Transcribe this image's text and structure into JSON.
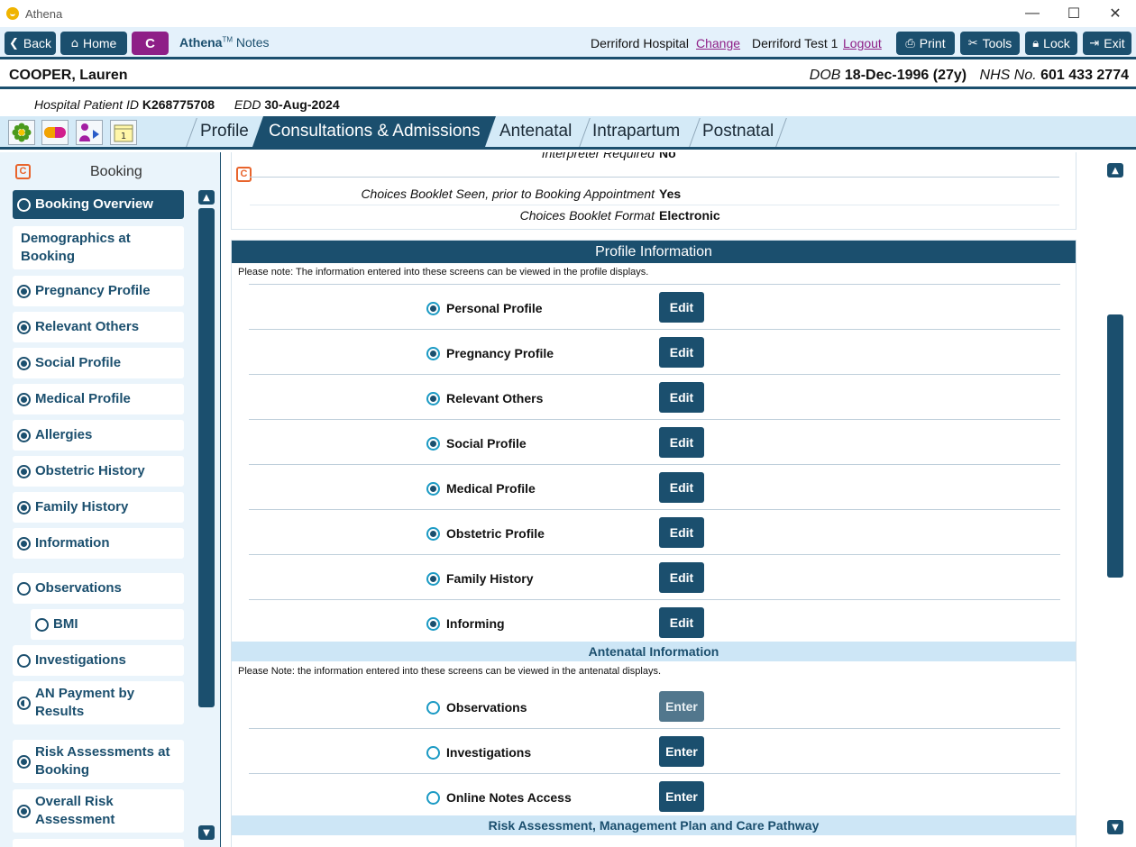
{
  "window": {
    "title": "Athena",
    "controls": [
      "—",
      "☐",
      "✕"
    ]
  },
  "toolbar": {
    "back": "Back",
    "home": "Home",
    "c_button": "C",
    "brand": "Athena",
    "brand_tm": "TM",
    "brand_suffix": "Notes",
    "hospital": "Derriford Hospital",
    "change": "Change",
    "user": "Derriford Test 1",
    "logout": "Logout",
    "print": "Print",
    "tools": "Tools",
    "lock": "Lock",
    "exit": "Exit"
  },
  "patient": {
    "name": "COOPER, Lauren",
    "dob_label": "DOB",
    "dob": "18-Dec-1996 (27y)",
    "nhs_label": "NHS No.",
    "nhs": "601 433 2774",
    "hospital_id_label": "Hospital Patient ID",
    "hospital_id": "K268775708",
    "edd_label": "EDD",
    "edd": "30-Aug-2024"
  },
  "tabs": [
    {
      "label": "Profile"
    },
    {
      "label": "Consultations & Admissions",
      "active": true
    },
    {
      "label": "Antenatal"
    },
    {
      "label": "Intrapartum"
    },
    {
      "label": "Postnatal"
    }
  ],
  "leftnav": {
    "badge": "C",
    "title": "Booking",
    "items": [
      {
        "label": "Booking Overview",
        "state": "empty",
        "active": true
      },
      {
        "label": "Demographics at Booking",
        "state": "none"
      },
      {
        "label": "Pregnancy Profile",
        "state": "filled"
      },
      {
        "label": "Relevant Others",
        "state": "filled"
      },
      {
        "label": "Social Profile",
        "state": "filled"
      },
      {
        "label": "Medical Profile",
        "state": "filled"
      },
      {
        "label": "Allergies",
        "state": "filled"
      },
      {
        "label": "Obstetric History",
        "state": "filled"
      },
      {
        "label": "Family History",
        "state": "filled"
      },
      {
        "label": "Information",
        "state": "filled"
      },
      {
        "label": "Observations",
        "state": "empty"
      },
      {
        "label": "BMI",
        "state": "empty",
        "sub": true
      },
      {
        "label": "Investigations",
        "state": "empty"
      },
      {
        "label": "AN Payment by Results",
        "state": "half"
      },
      {
        "label": "Risk Assessments at Booking",
        "state": "filled"
      },
      {
        "label": "Overall Risk Assessment",
        "state": "filled"
      }
    ]
  },
  "main": {
    "badge": "C",
    "top_fields": [
      {
        "label": "Interpreter Required",
        "value": "No"
      },
      {
        "label": "Choices Booklet Seen, prior to Booking Appointment",
        "value": "Yes"
      },
      {
        "label": "Choices Booklet Format",
        "value": "Electronic"
      }
    ],
    "profile_header": "Profile Information",
    "profile_note": "Please note: The information entered into these screens can be viewed in the profile displays.",
    "profile_rows": [
      {
        "label": "Personal Profile",
        "button": "Edit"
      },
      {
        "label": "Pregnancy Profile",
        "button": "Edit"
      },
      {
        "label": "Relevant Others",
        "button": "Edit"
      },
      {
        "label": "Social Profile",
        "button": "Edit"
      },
      {
        "label": "Medical Profile",
        "button": "Edit"
      },
      {
        "label": "Obstetric Profile",
        "button": "Edit"
      },
      {
        "label": "Family History",
        "button": "Edit"
      },
      {
        "label": "Informing",
        "button": "Edit"
      }
    ],
    "antenatal_header": "Antenatal Information",
    "antenatal_note": "Please Note: the information entered into these screens can be viewed in the antenatal displays.",
    "antenatal_rows": [
      {
        "label": "Observations",
        "button": "Enter",
        "dim": true
      },
      {
        "label": "Investigations",
        "button": "Enter"
      },
      {
        "label": "Online Notes Access",
        "button": "Enter"
      }
    ],
    "risk_header": "Risk Assessment, Management Plan and Care Pathway"
  },
  "colors": {
    "primary": "#1b4f6e",
    "accent": "#8e1f87",
    "badge": "#e8642c",
    "radio": "#1b9ac4",
    "tab_bg": "#d4eaf7"
  }
}
